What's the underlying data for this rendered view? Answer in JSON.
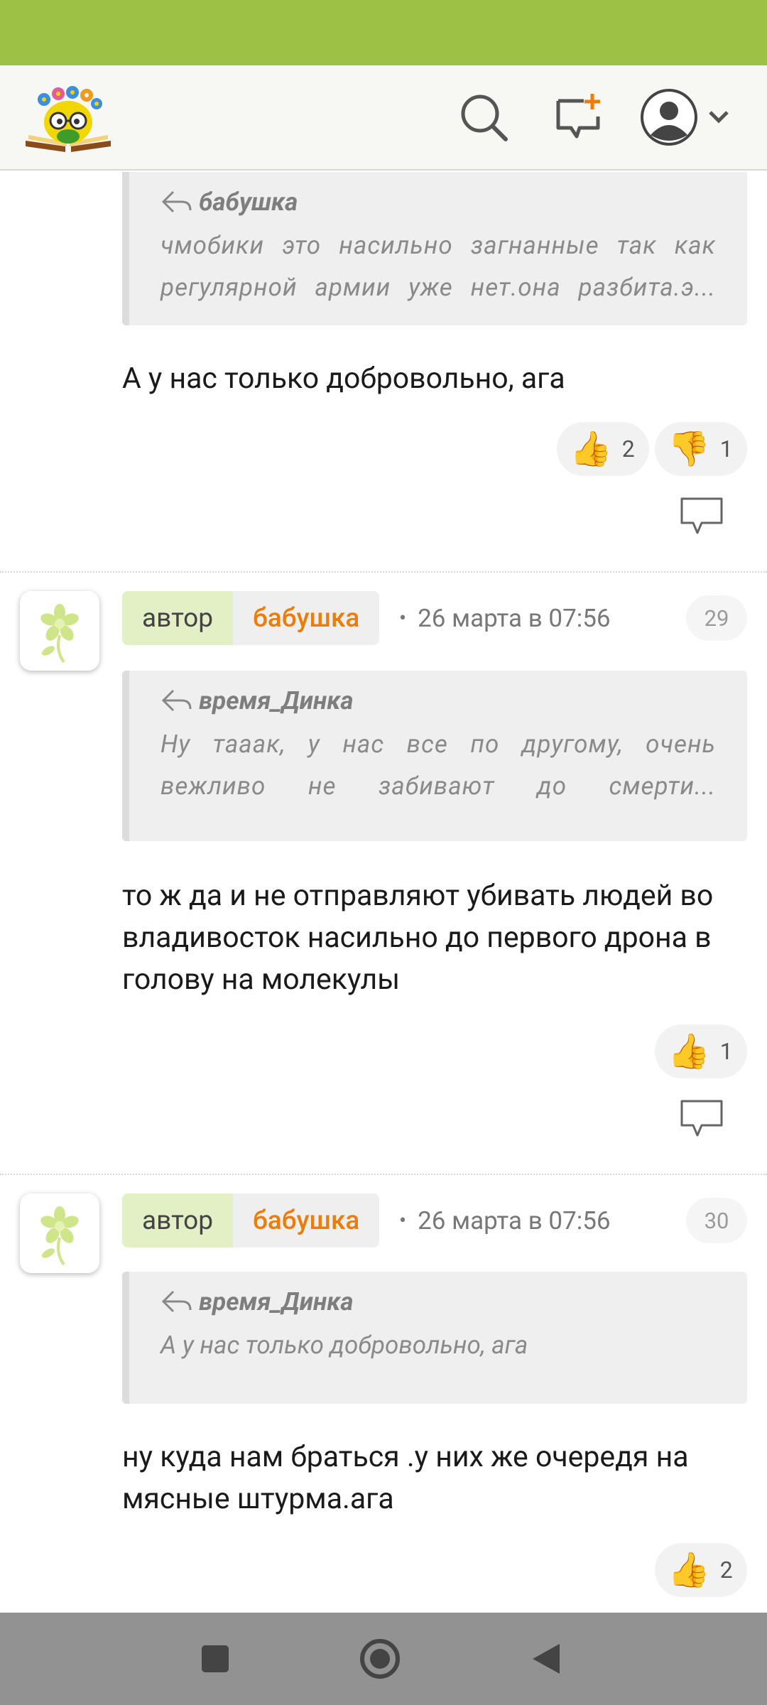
{
  "header": {
    "logo_icon": "reading-book-mascot-logo",
    "search_icon": "search-icon",
    "new_message_icon": "new-comment-icon",
    "profile_icon": "user-avatar-icon"
  },
  "comments": [
    {
      "quote_author": "бабушка",
      "quote_text": "чмобики это насильно загнанные так как регулярной армии уже нет.она разбита.э...",
      "text": "А у нас только добровольно, ага",
      "likes": "2",
      "dislikes": "1"
    },
    {
      "role": "автор",
      "author": "бабушка",
      "time": "26 марта в 07:56",
      "number": "29",
      "quote_author": "время_Динка",
      "quote_text": "Ну тааак, у нас все по другому, очень вежливо не забивают до смерти...",
      "text": "то ж да и не отправляют убивать людей во владивосток насильно до первого дрона в голову на молекулы",
      "likes": "1"
    },
    {
      "role": "автор",
      "author": "бабушка",
      "time": "26 марта в 07:56",
      "number": "30",
      "quote_author": "время_Динка",
      "quote_text": "А у нас только добровольно, ага",
      "text": "ну куда нам браться .у них же очередя на мясные штурма.ага",
      "likes": "2"
    }
  ],
  "icons": {
    "like": "👍",
    "dislike": "👎",
    "separator": "•"
  },
  "colors": {
    "status_bar": "#9dc144",
    "author_name": "#ed7d0a",
    "role_chip": "#e3efc4"
  }
}
